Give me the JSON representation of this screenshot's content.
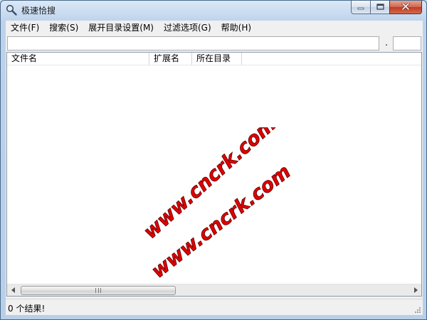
{
  "window": {
    "title": "极速恰搜",
    "icon": "magnifier-icon",
    "controls": [
      "minimize-icon",
      "maximize-icon",
      "close-icon"
    ]
  },
  "menu": {
    "items": [
      {
        "label": "文件(F)"
      },
      {
        "label": "搜索(S)"
      },
      {
        "label": "展开目录设置(M)"
      },
      {
        "label": "过滤选项(G)"
      },
      {
        "label": "帮助(H)"
      }
    ]
  },
  "search": {
    "query": "",
    "separator": ".",
    "extension": ""
  },
  "results": {
    "columns": [
      {
        "label": "文件名"
      },
      {
        "label": "扩展名"
      },
      {
        "label": "所在目录"
      }
    ],
    "rows": []
  },
  "watermark": {
    "lines": [
      "www.cncrk.com",
      "www.cncrk.com"
    ],
    "color": "#e00000"
  },
  "status": {
    "text": "0 个结果!"
  }
}
